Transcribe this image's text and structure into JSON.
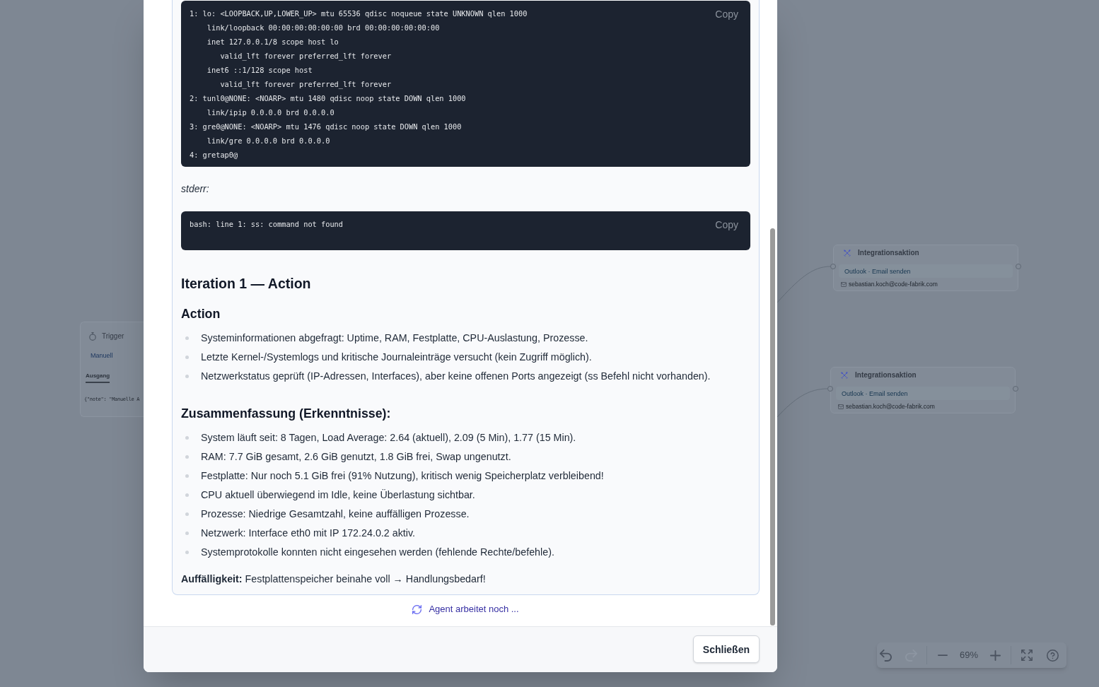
{
  "canvas": {
    "nodes": [
      {
        "kind": "trigger",
        "title": "Trigger",
        "subtitle": "Manuell",
        "tabs": [
          {
            "label": "Ausgang",
            "selected": true
          }
        ],
        "output": "{\"note\": \"Manuelle A"
      },
      {
        "kind": "integration",
        "title": "Integrationsaktion",
        "action": "Outlook · Email senden",
        "recipient": "sebastian.koch@code-fabrik.com"
      },
      {
        "kind": "integration",
        "title": "Integrationsaktion",
        "action": "Outlook · Email senden",
        "recipient": "sebastian.koch@code-fabrik.com"
      }
    ],
    "toolbar": {
      "groups": [
        [
          {
            "kind": "undo",
            "disabled": false
          },
          {
            "kind": "redo",
            "disabled": true
          }
        ],
        [
          {
            "kind": "zoom_out",
            "disabled": false
          },
          {
            "kind": "zoom_level",
            "text": "69%"
          },
          {
            "kind": "zoom_in",
            "disabled": false
          }
        ],
        [
          {
            "kind": "fit_view",
            "disabled": false
          },
          {
            "kind": "help",
            "disabled": false
          }
        ]
      ]
    }
  },
  "dialog": {
    "log": [
      {
        "kind": "code",
        "text": "1: lo: <LOOPBACK,UP,LOWER_UP> mtu 65536 qdisc noqueue state UNKNOWN qlen 1000\n    link/loopback 00:00:00:00:00:00 brd 00:00:00:00:00:00\n    inet 127.0.0.1/8 scope host lo\n       valid_lft forever preferred_lft forever\n    inet6 ::1/128 scope host\n       valid_lft forever preferred_lft forever\n2: tunl0@NONE: <NOARP> mtu 1480 qdisc noop state DOWN qlen 1000\n    link/ipip 0.0.0.0 brd 0.0.0.0\n3: gre0@NONE: <NOARP> mtu 1476 qdisc noop state DOWN qlen 1000\n    link/gre 0.0.0.0 brd 0.0.0.0\n4: gretap0@",
        "copy": "Copy"
      },
      {
        "kind": "label",
        "text": "stderr:"
      },
      {
        "kind": "code",
        "text": "bash: line 1: ss: command not found",
        "copy": "Copy"
      },
      {
        "kind": "heading",
        "text": "Iteration 1 — Action"
      },
      {
        "kind": "subheading",
        "text": "Action"
      },
      {
        "kind": "list",
        "items": [
          "Systeminformationen abgefragt: Uptime, RAM, Festplatte, CPU-Auslastung, Prozesse.",
          "Letzte Kernel-/Systemlogs und kritische Journaleinträge versucht (kein Zugriff möglich).",
          "Netzwerkstatus geprüft (IP-Adressen, Interfaces), aber keine offenen Ports angezeigt (ss Befehl nicht vorhanden)."
        ]
      },
      {
        "kind": "subheading",
        "text": "Zusammenfassung (Erkenntnisse):"
      },
      {
        "kind": "list",
        "items": [
          "System läuft seit: 8 Tagen, Load Average: 2.64 (aktuell), 2.09 (5 Min), 1.77 (15 Min).",
          "RAM: 7.7 GiB gesamt, 2.6 GiB genutzt, 1.8 GiB frei, Swap ungenutzt.",
          "Festplatte: Nur noch 5.1 GiB frei (91% Nutzung), kritisch wenig Speicherplatz verbleibend!",
          "CPU aktuell überwiegend im Idle, keine Überlastung sichtbar.",
          "Prozesse: Niedrige Gesamtzahl, keine auffälligen Prozesse.",
          "Netzwerk: Interface eth0 mit IP 172.24.0.2 aktiv.",
          "Systemprotokolle konnten nicht eingesehen werden (fehlende Rechte/befehle)."
        ]
      },
      {
        "kind": "paragraph",
        "text": "**Auffälligkeit:** Festplattenspeicher beinahe voll → Handlungsbedarf!"
      }
    ],
    "status": "Agent arbeitet noch ...",
    "buttons": [
      {
        "label": "Schließen"
      }
    ]
  }
}
